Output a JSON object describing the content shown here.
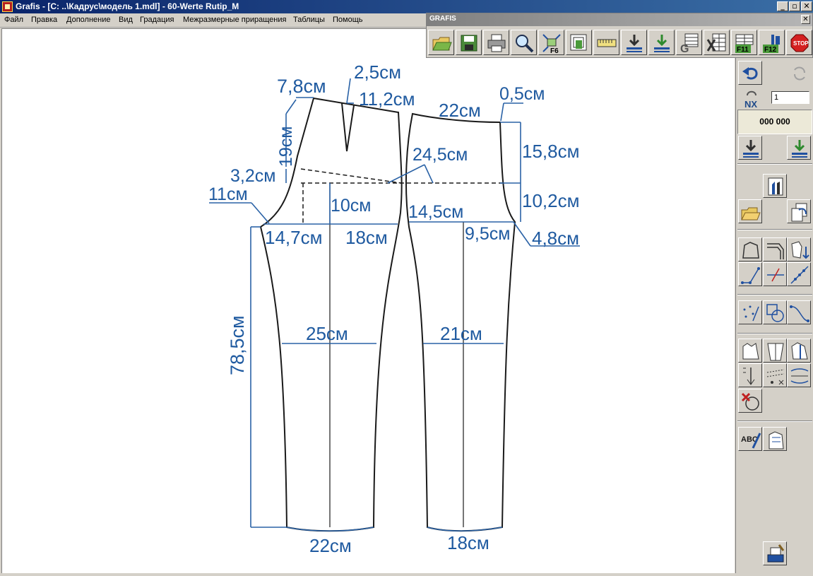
{
  "window": {
    "title": "Grafis - [C: ..\\Кадрус\\модель 1.mdl] - 60-Werte Rutip_M",
    "controls": [
      "_",
      "▫",
      "✕"
    ]
  },
  "menu": [
    "Файл",
    "Правка",
    "Дополнение",
    "Вид",
    "Градация",
    "Межразмерные приращения",
    "Таблицы",
    "Помощь"
  ],
  "toolbar": {
    "title": "GRAFIS",
    "close": "✕",
    "buttons": [
      "open-folder-icon",
      "save-icon",
      "print-icon",
      "zoom-icon",
      "f6-fit-icon",
      "pieces-icon",
      "measure-tape-icon",
      "load-icon",
      "load-green-icon",
      "grading-g-icon",
      "excel-table-icon",
      "f11-icon",
      "f12-icon",
      "stop-icon"
    ],
    "labels": {
      "f6": "F6",
      "f11": "F11",
      "f12": "F12",
      "stop": "STOP",
      "grading": "G"
    }
  },
  "panel": {
    "nx_value": "1",
    "nx_label": "NX",
    "counter": "000 000",
    "text_tool_label": "ABC"
  },
  "pattern": {
    "colors": {
      "outline": "#1a1a1a",
      "dimension": "#1f5aa0"
    },
    "dimensions": {
      "waist_left": "7,8см",
      "dart_width": "2,5см",
      "front_waist": "11,2см",
      "back_waist": "22см",
      "back_rise_top": "0,5см",
      "yoke_depth": "19см",
      "side_offset": "3,2см",
      "hip_line": "24,5см",
      "back_rise": "15,8см",
      "front_crotch": "11см",
      "front_rise": "10см",
      "back_hip": "14,5см",
      "back_crotch_depth": "10,2см",
      "front_half_left": "14,7см",
      "front_half_right": "18см",
      "back_half_right": "9,5см",
      "back_crotch": "4,8см",
      "length": "78,5см",
      "front_knee": "25см",
      "back_knee": "21см",
      "front_hem": "22см",
      "back_hem": "18см"
    }
  }
}
